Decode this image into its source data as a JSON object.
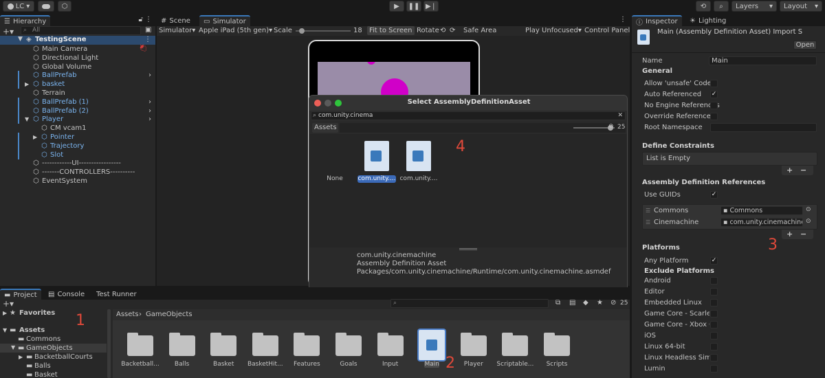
{
  "toolbar": {
    "account": "LC",
    "layers": "Layers",
    "layout": "Layout"
  },
  "hierarchy": {
    "tab": "Hierarchy",
    "search_placeholder": "All",
    "scene": "TestingScene",
    "items": [
      {
        "label": "Main Camera",
        "blue": false
      },
      {
        "label": "Directional Light",
        "blue": false
      },
      {
        "label": "Global Volume",
        "blue": false
      },
      {
        "label": "BallPrefab",
        "blue": true
      },
      {
        "label": "basket",
        "blue": true
      },
      {
        "label": "Terrain",
        "blue": false
      },
      {
        "label": "BallPrefab (1)",
        "blue": true
      },
      {
        "label": "BallPrefab (2)",
        "blue": true
      },
      {
        "label": "Player",
        "blue": true
      },
      {
        "label": "CM vcam1",
        "blue": false
      },
      {
        "label": "Pointer",
        "blue": true
      },
      {
        "label": "Trajectory",
        "blue": true
      },
      {
        "label": "Slot",
        "blue": true
      },
      {
        "label": "------------UI-----------------",
        "blue": false
      },
      {
        "label": "-------CONTROLLERS----------",
        "blue": false
      },
      {
        "label": "EventSystem",
        "blue": false
      }
    ]
  },
  "center_tabs": {
    "scene": "Scene",
    "simulator": "Simulator"
  },
  "sim_toolbar": {
    "mode": "Simulator",
    "device": "Apple iPad (5th gen)",
    "scale_label": "Scale",
    "scale_value": "18",
    "fit": "Fit to Screen",
    "rotate": "Rotate",
    "safe_area": "Safe Area",
    "play_mode": "Play Unfocused",
    "control_panel": "Control Panel"
  },
  "inspector": {
    "tabs": [
      "Inspector",
      "Lighting"
    ],
    "title": "Main (Assembly Definition Asset) Import S",
    "open": "Open",
    "name_label": "Name",
    "name_value": "Main",
    "general": "General",
    "general_rows": [
      {
        "label": "Allow 'unsafe' Code",
        "checked": false
      },
      {
        "label": "Auto Referenced",
        "checked": true
      },
      {
        "label": "No Engine References",
        "checked": false
      },
      {
        "label": "Override References",
        "checked": false
      }
    ],
    "root_namespace": "Root Namespace",
    "define_constraints": "Define Constraints",
    "list_empty": "List is Empty",
    "asm_refs": "Assembly Definition References",
    "use_guids": "Use GUIDs",
    "refs": [
      {
        "label": "Commons",
        "value": "Commons"
      },
      {
        "label": "Cinemachine",
        "value": "com.unity.cinemachine"
      }
    ],
    "platforms": "Platforms",
    "any_platform": "Any Platform",
    "exclude_platforms": "Exclude Platforms",
    "platform_list": [
      "Android",
      "Editor",
      "Embedded Linux",
      "Game Core - Scarlett",
      "Game Core - Xbox One",
      "iOS",
      "Linux 64-bit",
      "Linux Headless Simulation",
      "Lumin"
    ]
  },
  "dialog": {
    "title": "Select AssemblyDefinitionAsset",
    "search": "com.unity.cinema",
    "assets_tab": "Assets",
    "count": "25",
    "items": [
      "None",
      "com.unity....",
      "com.unity...."
    ],
    "info_name": "com.unity.cinemachine",
    "info_type": "Assembly Definition Asset",
    "info_path": "Packages/com.unity.cinemachine/Runtime/com.unity.cinemachine.asmdef"
  },
  "project": {
    "tabs": [
      "Project",
      "Console",
      "Test Runner"
    ],
    "count": "25",
    "favorites": "Favorites",
    "assets": "Assets",
    "tree": [
      "Commons",
      "GameObjects",
      "BacketballCourts",
      "Balls",
      "Basket"
    ],
    "breadcrumb": [
      "Assets",
      "GameObjects"
    ],
    "folders": [
      "Backetball...",
      "Balls",
      "Basket",
      "BasketHit...",
      "Features",
      "Goals",
      "Input",
      "Main",
      "Player",
      "Scriptable...",
      "Scripts"
    ]
  },
  "annotations": [
    "1",
    "2",
    "3",
    "4"
  ]
}
